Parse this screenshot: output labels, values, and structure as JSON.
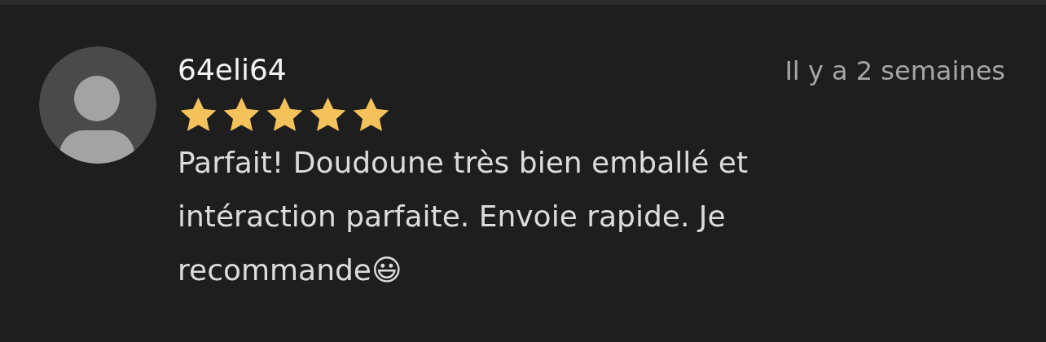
{
  "review": {
    "author": "64eli64",
    "time": "Il y a 2 semaines",
    "stars": 5,
    "text": "Parfait! Doudoune très bien emballé et intéraction parfaite. Envoie rapide. Je recommande😃"
  }
}
